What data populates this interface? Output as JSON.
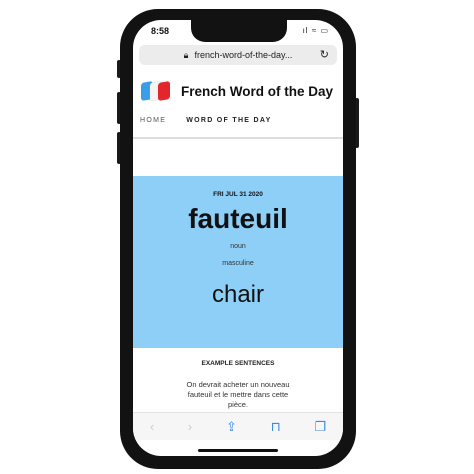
{
  "status": {
    "time": "8:58",
    "icons": "signal wifi battery"
  },
  "browser": {
    "url": "french-word-of-the-day...",
    "lock_icon": "lock",
    "reload_icon": "reload"
  },
  "header": {
    "title": "French Word of the Day"
  },
  "nav": [
    {
      "label": "HOME"
    },
    {
      "label": "WORD OF THE DAY"
    }
  ],
  "word": {
    "date": "FRI JUL 31 2020",
    "french": "fauteuil",
    "part_of_speech": "noun",
    "gender": "masculine",
    "translation": "chair"
  },
  "examples": {
    "heading": "EXAMPLE SENTENCES",
    "sentence": "On devrait acheter un nouveau fauteuil et le mettre dans cette pièce."
  },
  "toolbar": {
    "back": "‹",
    "forward": "›",
    "share": "⇪",
    "bookmarks": "📖",
    "tabs": "❐"
  },
  "colors": {
    "hero_bg": "#8ecff8"
  }
}
